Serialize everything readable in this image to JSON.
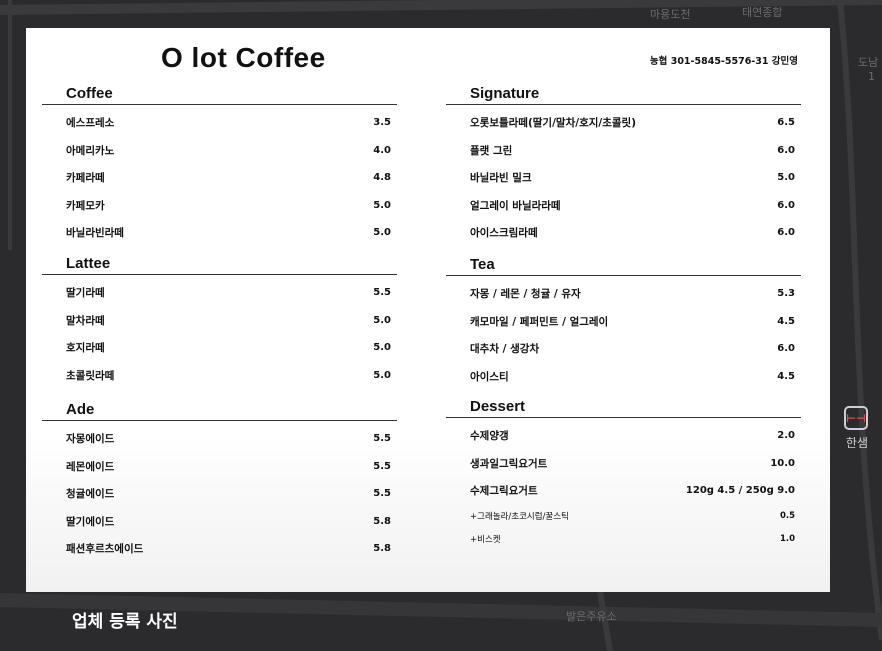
{
  "map": {
    "labels": [
      "태연종합",
      "마용도천",
      "도남",
      "1",
      "발은주유소"
    ],
    "station_label": "한샘",
    "station_icon": "subway-station-icon"
  },
  "menu": {
    "title": "O lot Coffee",
    "account": "농협 301-5845-5576-31 강민영",
    "left_sections": [
      {
        "name": "Coffee",
        "items": [
          {
            "name": "에스프레소",
            "price": "3.5"
          },
          {
            "name": "아메리카노",
            "price": "4.0"
          },
          {
            "name": "카페라떼",
            "price": "4.8"
          },
          {
            "name": "카페모카",
            "price": "5.0"
          },
          {
            "name": "바닐라빈라떼",
            "price": "5.0"
          }
        ]
      },
      {
        "name": "Lattee",
        "items": [
          {
            "name": "딸기라떼",
            "price": "5.5"
          },
          {
            "name": "말차라떼",
            "price": "5.0"
          },
          {
            "name": "호지라떼",
            "price": "5.0"
          },
          {
            "name": "초콜릿라떼",
            "price": "5.0"
          }
        ]
      },
      {
        "name": "Ade",
        "items": [
          {
            "name": "자몽에이드",
            "price": "5.5"
          },
          {
            "name": "레몬에이드",
            "price": "5.5"
          },
          {
            "name": "청귤에이드",
            "price": "5.5"
          },
          {
            "name": "딸기에이드",
            "price": "5.8"
          },
          {
            "name": "패션후르츠에이드",
            "price": "5.8"
          }
        ]
      }
    ],
    "right_sections": [
      {
        "name": "Signature",
        "items": [
          {
            "name": "오롯보틀라떼(딸기/말차/호지/초콜릿)",
            "price": "6.5"
          },
          {
            "name": "플랫 그린",
            "price": "6.0"
          },
          {
            "name": "바닐라빈 밀크",
            "price": "5.0"
          },
          {
            "name": "얼그레이 바닐라라떼",
            "price": "6.0"
          },
          {
            "name": "아이스크림라떼",
            "price": "6.0"
          }
        ]
      },
      {
        "name": "Tea",
        "items": [
          {
            "name": "자몽 / 레몬 / 청귤 / 유자",
            "price": "5.3"
          },
          {
            "name": "캐모마일 / 페퍼민트 / 얼그레이",
            "price": "4.5"
          },
          {
            "name": "대추차 / 생강차",
            "price": "6.0"
          },
          {
            "name": "아이스티",
            "price": "4.5"
          }
        ]
      },
      {
        "name": "Dessert",
        "items": [
          {
            "name": "수제양갱",
            "price": "2.0"
          },
          {
            "name": "생과일그릭요거트",
            "price": "10.0"
          },
          {
            "name": "수제그릭요거트",
            "price": "120g 4.5 / 250g 9.0"
          }
        ],
        "addons": [
          {
            "name": "+그래놀라/초코시럽/꿀스틱",
            "price": "0.5"
          },
          {
            "name": "+비스켓",
            "price": "1.0"
          }
        ]
      }
    ]
  },
  "caption": "업체 등록 사진"
}
